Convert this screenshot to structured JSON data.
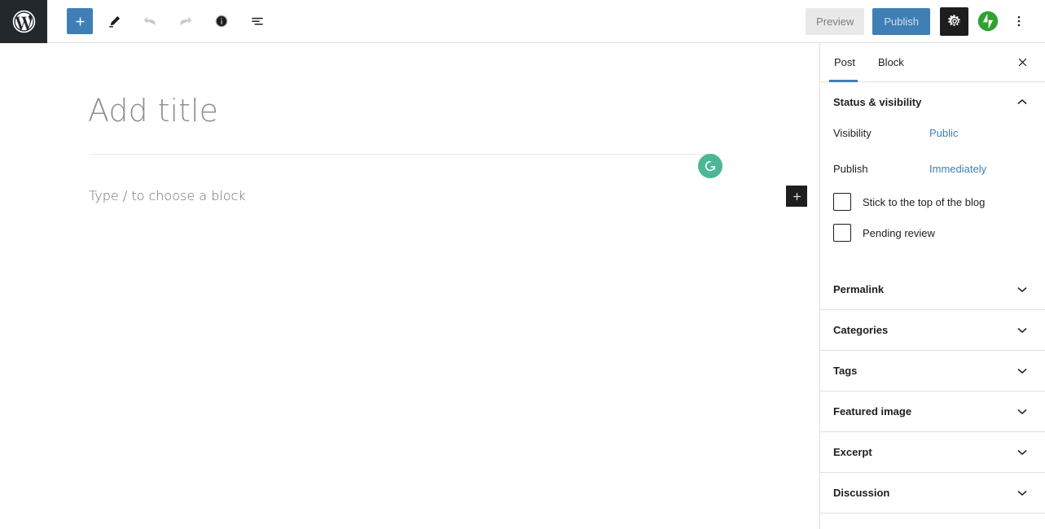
{
  "app": {
    "name": "WordPress Block Editor"
  },
  "toolbar": {
    "logo_icon": "wordpress-logo-icon",
    "inserter_icon": "plus-icon",
    "tools_icon": "pencil-edit-icon",
    "undo_icon": "undo-arrow-icon",
    "redo_icon": "redo-arrow-icon",
    "info_icon": "info-circle-icon",
    "list_view_icon": "list-view-icon",
    "preview_label": "Preview",
    "publish_label": "Publish",
    "settings_icon": "gear-icon",
    "jetpack_icon": "jetpack-icon",
    "more_icon": "three-dots-vertical-icon",
    "accent_blue": "#3f7fb5",
    "preview_bg": "#e9e9e9",
    "logo_bg": "#23282d"
  },
  "editor": {
    "title_placeholder": "Add title",
    "title_value": "",
    "block_placeholder": "Type / to choose a block",
    "grammarly_icon": "grammarly-g-icon",
    "grammarly_color": "#4cb795",
    "block_inserter_icon": "plus-icon"
  },
  "sidebar": {
    "tabs": [
      {
        "label": "Post",
        "active": true
      },
      {
        "label": "Block",
        "active": false
      }
    ],
    "close_icon": "close-icon",
    "status_panel": {
      "title": "Status & visibility",
      "toggle_icon": "chevron-up-icon",
      "rows": [
        {
          "label": "Visibility",
          "value": "Public"
        },
        {
          "label": "Publish",
          "value": "Immediately"
        }
      ],
      "checkboxes": [
        {
          "label": "Stick to the top of the blog",
          "checked": false
        },
        {
          "label": "Pending review",
          "checked": false
        }
      ]
    },
    "panels": [
      {
        "label": "Permalink",
        "toggle_icon": "chevron-down-icon"
      },
      {
        "label": "Categories",
        "toggle_icon": "chevron-down-icon"
      },
      {
        "label": "Tags",
        "toggle_icon": "chevron-down-icon"
      },
      {
        "label": "Featured image",
        "toggle_icon": "chevron-down-icon"
      },
      {
        "label": "Excerpt",
        "toggle_icon": "chevron-down-icon"
      },
      {
        "label": "Discussion",
        "toggle_icon": "chevron-down-icon"
      }
    ]
  }
}
